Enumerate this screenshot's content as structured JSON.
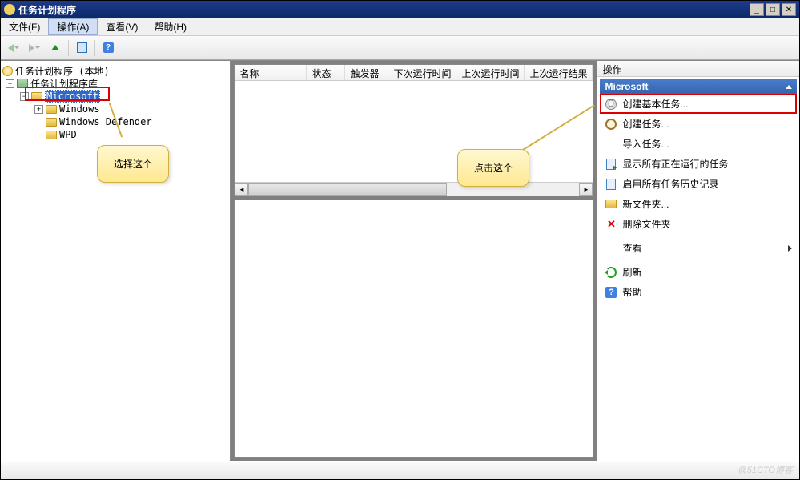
{
  "window": {
    "title": "任务计划程序"
  },
  "menu": {
    "file": "文件(F)",
    "action": "操作(A)",
    "view": "查看(V)",
    "help": "帮助(H)"
  },
  "tree": {
    "root": "任务计划程序 (本地)",
    "library": "任务计划程序库",
    "microsoft": "Microsoft",
    "windows": "Windows",
    "defender": "Windows Defender",
    "wpd": "WPD"
  },
  "list": {
    "columns": {
      "name": "名称",
      "status": "状态",
      "trigger": "触发器",
      "nextRun": "下次运行时间",
      "lastRun": "上次运行时间",
      "lastResult": "上次运行结果"
    }
  },
  "actions": {
    "panelTitle": "操作",
    "section": "Microsoft",
    "createBasicTask": "创建基本任务...",
    "createTask": "创建任务...",
    "importTask": "导入任务...",
    "showRunning": "显示所有正在运行的任务",
    "enableHistory": "启用所有任务历史记录",
    "newFolder": "新文件夹...",
    "deleteFolder": "删除文件夹",
    "view": "查看",
    "refresh": "刷新",
    "help": "帮助"
  },
  "callouts": {
    "selectThis": "选择这个",
    "clickThis": "点击这个"
  },
  "watermark": "@51CTO博客"
}
